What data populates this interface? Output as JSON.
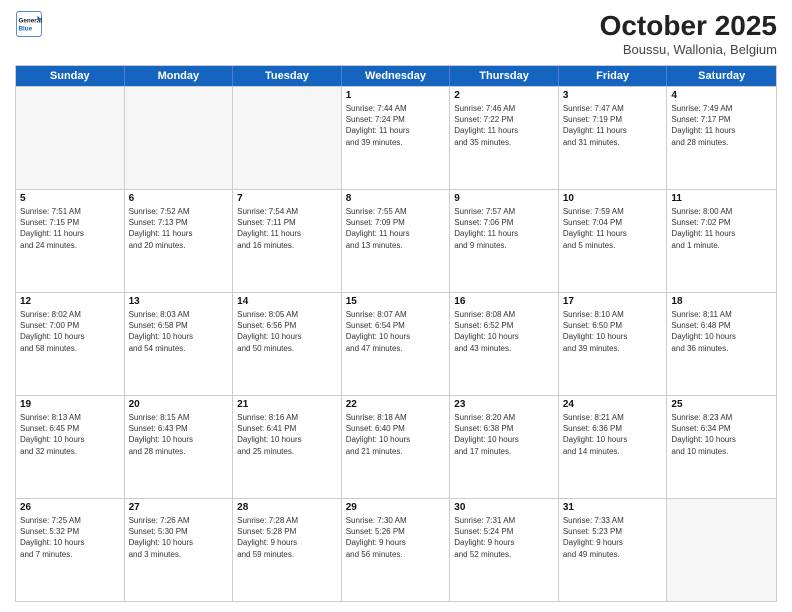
{
  "header": {
    "logo": {
      "line1": "General",
      "line2": "Blue"
    },
    "title": "October 2025",
    "location": "Boussu, Wallonia, Belgium"
  },
  "dayHeaders": [
    "Sunday",
    "Monday",
    "Tuesday",
    "Wednesday",
    "Thursday",
    "Friday",
    "Saturday"
  ],
  "weeks": [
    [
      {
        "day": "",
        "info": "",
        "empty": true
      },
      {
        "day": "",
        "info": "",
        "empty": true
      },
      {
        "day": "",
        "info": "",
        "empty": true
      },
      {
        "day": "1",
        "info": "Sunrise: 7:44 AM\nSunset: 7:24 PM\nDaylight: 11 hours\nand 39 minutes."
      },
      {
        "day": "2",
        "info": "Sunrise: 7:46 AM\nSunset: 7:22 PM\nDaylight: 11 hours\nand 35 minutes."
      },
      {
        "day": "3",
        "info": "Sunrise: 7:47 AM\nSunset: 7:19 PM\nDaylight: 11 hours\nand 31 minutes."
      },
      {
        "day": "4",
        "info": "Sunrise: 7:49 AM\nSunset: 7:17 PM\nDaylight: 11 hours\nand 28 minutes."
      }
    ],
    [
      {
        "day": "5",
        "info": "Sunrise: 7:51 AM\nSunset: 7:15 PM\nDaylight: 11 hours\nand 24 minutes."
      },
      {
        "day": "6",
        "info": "Sunrise: 7:52 AM\nSunset: 7:13 PM\nDaylight: 11 hours\nand 20 minutes."
      },
      {
        "day": "7",
        "info": "Sunrise: 7:54 AM\nSunset: 7:11 PM\nDaylight: 11 hours\nand 16 minutes."
      },
      {
        "day": "8",
        "info": "Sunrise: 7:55 AM\nSunset: 7:09 PM\nDaylight: 11 hours\nand 13 minutes."
      },
      {
        "day": "9",
        "info": "Sunrise: 7:57 AM\nSunset: 7:06 PM\nDaylight: 11 hours\nand 9 minutes."
      },
      {
        "day": "10",
        "info": "Sunrise: 7:59 AM\nSunset: 7:04 PM\nDaylight: 11 hours\nand 5 minutes."
      },
      {
        "day": "11",
        "info": "Sunrise: 8:00 AM\nSunset: 7:02 PM\nDaylight: 11 hours\nand 1 minute."
      }
    ],
    [
      {
        "day": "12",
        "info": "Sunrise: 8:02 AM\nSunset: 7:00 PM\nDaylight: 10 hours\nand 58 minutes."
      },
      {
        "day": "13",
        "info": "Sunrise: 8:03 AM\nSunset: 6:58 PM\nDaylight: 10 hours\nand 54 minutes."
      },
      {
        "day": "14",
        "info": "Sunrise: 8:05 AM\nSunset: 6:56 PM\nDaylight: 10 hours\nand 50 minutes."
      },
      {
        "day": "15",
        "info": "Sunrise: 8:07 AM\nSunset: 6:54 PM\nDaylight: 10 hours\nand 47 minutes."
      },
      {
        "day": "16",
        "info": "Sunrise: 8:08 AM\nSunset: 6:52 PM\nDaylight: 10 hours\nand 43 minutes."
      },
      {
        "day": "17",
        "info": "Sunrise: 8:10 AM\nSunset: 6:50 PM\nDaylight: 10 hours\nand 39 minutes."
      },
      {
        "day": "18",
        "info": "Sunrise: 8:11 AM\nSunset: 6:48 PM\nDaylight: 10 hours\nand 36 minutes."
      }
    ],
    [
      {
        "day": "19",
        "info": "Sunrise: 8:13 AM\nSunset: 6:45 PM\nDaylight: 10 hours\nand 32 minutes."
      },
      {
        "day": "20",
        "info": "Sunrise: 8:15 AM\nSunset: 6:43 PM\nDaylight: 10 hours\nand 28 minutes."
      },
      {
        "day": "21",
        "info": "Sunrise: 8:16 AM\nSunset: 6:41 PM\nDaylight: 10 hours\nand 25 minutes."
      },
      {
        "day": "22",
        "info": "Sunrise: 8:18 AM\nSunset: 6:40 PM\nDaylight: 10 hours\nand 21 minutes."
      },
      {
        "day": "23",
        "info": "Sunrise: 8:20 AM\nSunset: 6:38 PM\nDaylight: 10 hours\nand 17 minutes."
      },
      {
        "day": "24",
        "info": "Sunrise: 8:21 AM\nSunset: 6:36 PM\nDaylight: 10 hours\nand 14 minutes."
      },
      {
        "day": "25",
        "info": "Sunrise: 8:23 AM\nSunset: 6:34 PM\nDaylight: 10 hours\nand 10 minutes."
      }
    ],
    [
      {
        "day": "26",
        "info": "Sunrise: 7:25 AM\nSunset: 5:32 PM\nDaylight: 10 hours\nand 7 minutes."
      },
      {
        "day": "27",
        "info": "Sunrise: 7:26 AM\nSunset: 5:30 PM\nDaylight: 10 hours\nand 3 minutes."
      },
      {
        "day": "28",
        "info": "Sunrise: 7:28 AM\nSunset: 5:28 PM\nDaylight: 9 hours\nand 59 minutes."
      },
      {
        "day": "29",
        "info": "Sunrise: 7:30 AM\nSunset: 5:26 PM\nDaylight: 9 hours\nand 56 minutes."
      },
      {
        "day": "30",
        "info": "Sunrise: 7:31 AM\nSunset: 5:24 PM\nDaylight: 9 hours\nand 52 minutes."
      },
      {
        "day": "31",
        "info": "Sunrise: 7:33 AM\nSunset: 5:23 PM\nDaylight: 9 hours\nand 49 minutes."
      },
      {
        "day": "",
        "info": "",
        "empty": true
      }
    ]
  ]
}
